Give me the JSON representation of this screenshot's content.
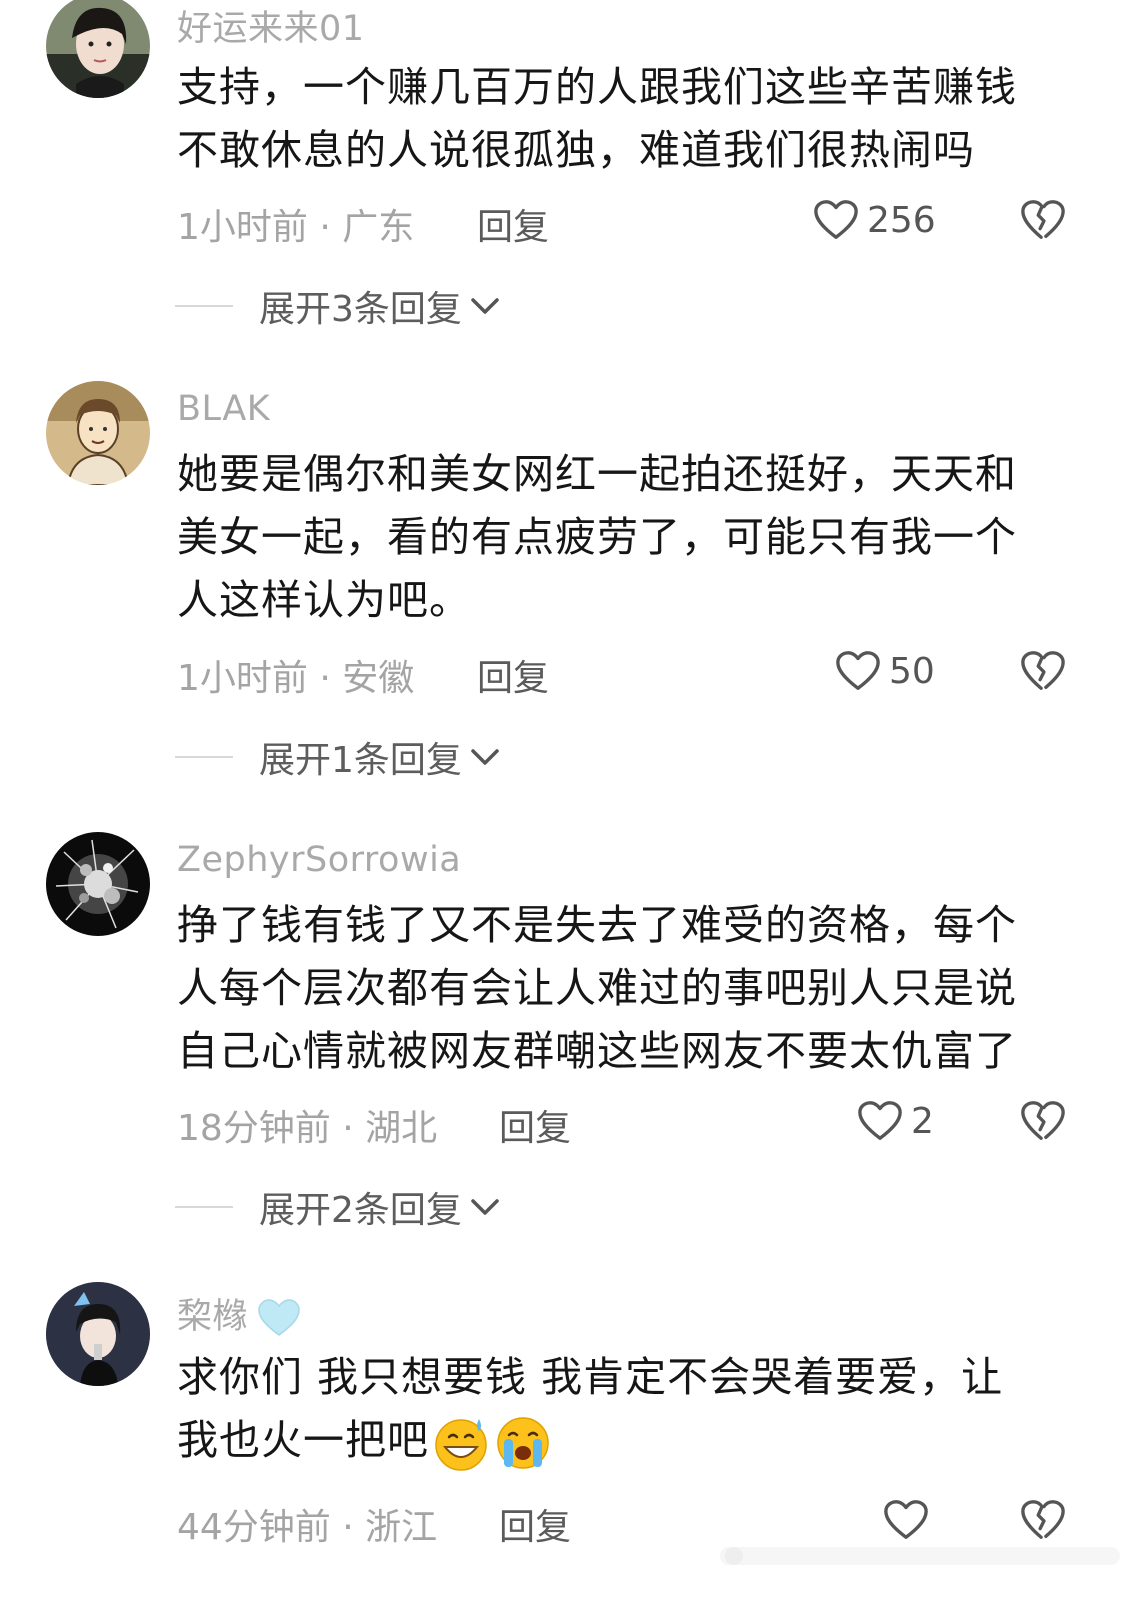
{
  "comments": [
    {
      "username": "好运来来01",
      "lines": [
        "支持，一个赚几百万的人跟我们这些辛苦赚钱",
        "不敢休息的人说很孤独，难道我们很热闹吗"
      ],
      "time": "1小时前 · 广东",
      "reply_label": "回复",
      "likes": "256",
      "expand_label": "展开3条回复"
    },
    {
      "username": "BLAK",
      "lines": [
        "她要是偶尔和美女网红一起拍还挺好，天天和",
        "美女一起，看的有点疲劳了，可能只有我一个",
        "人这样认为吧。"
      ],
      "time": "1小时前 · 安徽",
      "reply_label": "回复",
      "likes": "50",
      "expand_label": "展开1条回复"
    },
    {
      "username": "ZephyrSorrowia",
      "lines": [
        "挣了钱有钱了又不是失去了难受的资格，每个",
        "人每个层次都有会让人难过的事吧别人只是说",
        "自己心情就被网友群嘲这些网友不要太仇富了"
      ],
      "time": "18分钟前 · 湖北",
      "reply_label": "回复",
      "likes": "2",
      "expand_label": "展开2条回复"
    },
    {
      "username": "棃橼",
      "lines": [
        "求你们 我只想要钱 我肯定不会哭着要爱，让",
        "我也火一把吧"
      ],
      "time": "44分钟前 · 浙江",
      "reply_label": "回复",
      "likes": ""
    }
  ],
  "icons": {
    "like": "heart-outline-icon",
    "dislike": "broken-heart-icon",
    "expand": "chevron-down-icon",
    "badge": "light-blue-heart-icon",
    "emojis": [
      "grinning-sweat-emoji",
      "loudly-crying-emoji"
    ]
  },
  "colors": {
    "username": "#a9a9a9",
    "body": "#161616",
    "meta": "#a4a4a4",
    "badge": "#bfe9f5"
  }
}
